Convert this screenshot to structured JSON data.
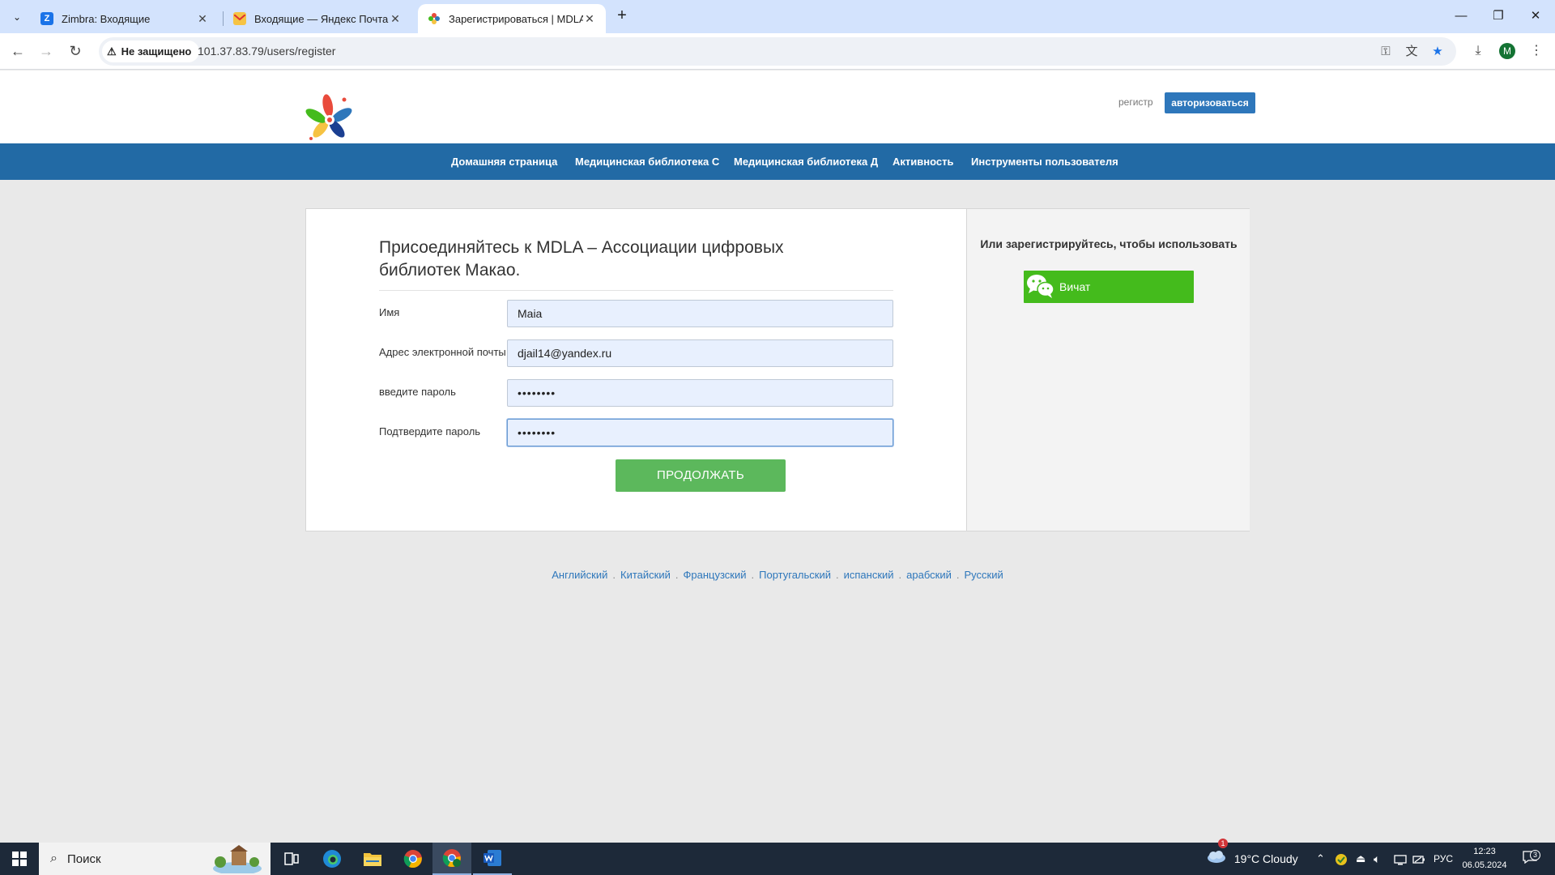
{
  "browser": {
    "tabs": [
      {
        "title": "Zimbra: Входящие",
        "icon": "zimbra-icon",
        "active": false
      },
      {
        "title": "Входящие — Яндекс Почта",
        "icon": "yandex-mail-icon",
        "active": false
      },
      {
        "title": "Зарегистрироваться | MDLA –",
        "icon": "mdla-favicon",
        "active": true
      }
    ],
    "security_label": "Не защищено",
    "url": "101.37.83.79/users/register",
    "profile_initial": "M"
  },
  "site": {
    "register_link": "регистр",
    "login_button": "авторизоваться",
    "nav": [
      "Домашняя страница",
      "Медицинская библиотека С",
      "Медицинская библиотека Д",
      "Активность",
      "Инструменты пользователя"
    ]
  },
  "form": {
    "title": "Присоединяйтесь к MDLA – Ассоциации цифровых библиотек Макао.",
    "fields": [
      {
        "label": "Имя",
        "value": "Maia",
        "type": "text"
      },
      {
        "label": "Адрес электронной почты",
        "value": "djail14@yandex.ru",
        "type": "text"
      },
      {
        "label": "введите пароль",
        "value": "••••••••",
        "type": "password"
      },
      {
        "label": "Подтвердите пароль",
        "value": "••••••••",
        "type": "password"
      }
    ],
    "submit": "ПРОДОЛЖАТЬ"
  },
  "alt_signup": {
    "title": "Или зарегистрируйтесь, чтобы использовать",
    "wechat_button": "Вичат"
  },
  "languages": [
    "Английский",
    "Китайский",
    "Французский",
    "Португальский",
    "испанский",
    "арабский",
    "Русский"
  ],
  "taskbar": {
    "search_placeholder": "Поиск",
    "weather": "19°C  Cloudy",
    "weather_badge": "1",
    "input_lang": "РУС",
    "time": "12:23",
    "date": "06.05.2024",
    "notifications": "3"
  },
  "colors": {
    "navbar": "#226aa5",
    "login_button": "#2e77bb",
    "submit": "#5cb85c",
    "wechat": "#44bb1c"
  }
}
